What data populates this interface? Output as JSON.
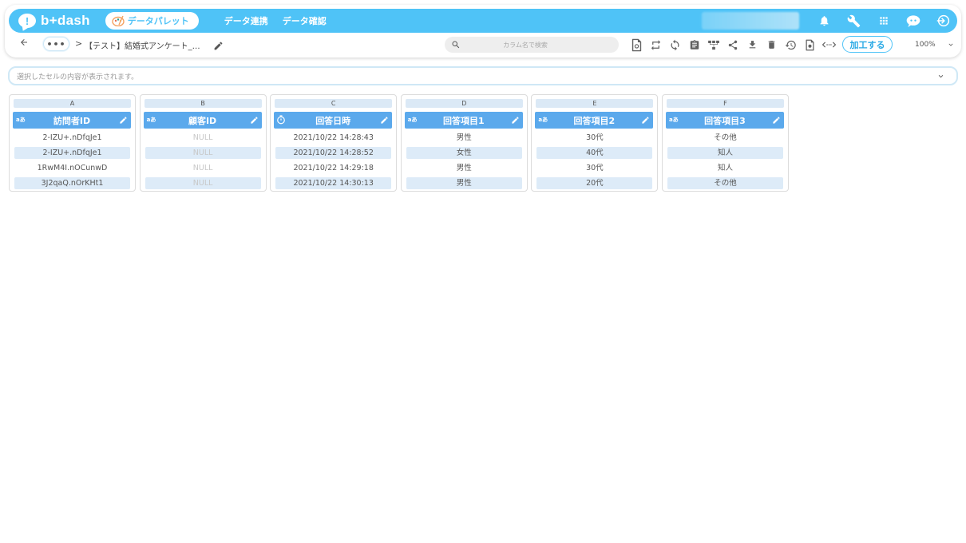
{
  "app": {
    "logo_text": "b+dash"
  },
  "nav": {
    "palette_label": "データパレット",
    "links": [
      "データ連携",
      "データ確認"
    ]
  },
  "toolbar": {
    "more_label": "•••",
    "separator": ">",
    "breadcrumb_title": "【テスト】結婚式アンケート_…",
    "search_placeholder": "カラム名で検索",
    "process_label": "加工する",
    "zoom_value": "100%"
  },
  "cellbar": {
    "placeholder": "選択したセルの内容が表示されます。"
  },
  "columns": [
    {
      "letter": "A",
      "title": "訪問者ID",
      "type_icon": "text-type-icon",
      "cells": [
        "2-IZU+.nDfqJe1",
        "2-IZU+.nDfqJe1",
        "1RwM4I.nOCunwD",
        "3J2qaQ.nOrKHt1"
      ]
    },
    {
      "letter": "B",
      "title": "顧客ID",
      "type_icon": "text-type-icon",
      "cells": [
        "NULL",
        "NULL",
        "NULL",
        "NULL"
      ]
    },
    {
      "letter": "C",
      "title": "回答日時",
      "type_icon": "clock-icon",
      "cells": [
        "2021/10/22 14:28:43",
        "2021/10/22 14:28:52",
        "2021/10/22 14:29:18",
        "2021/10/22 14:30:13"
      ]
    },
    {
      "letter": "D",
      "title": "回答項目1",
      "type_icon": "text-type-icon",
      "cells": [
        "男性",
        "女性",
        "男性",
        "男性"
      ]
    },
    {
      "letter": "E",
      "title": "回答項目2",
      "type_icon": "text-type-icon",
      "cells": [
        "30代",
        "40代",
        "30代",
        "20代"
      ]
    },
    {
      "letter": "F",
      "title": "回答項目3",
      "type_icon": "text-type-icon",
      "cells": [
        "その他",
        "知人",
        "知人",
        "その他"
      ]
    }
  ],
  "type_badge": "aあ",
  "colors": {
    "brand": "#4fc3f7",
    "column_header": "#5ba9ec",
    "alt_row": "#ddebf8"
  }
}
